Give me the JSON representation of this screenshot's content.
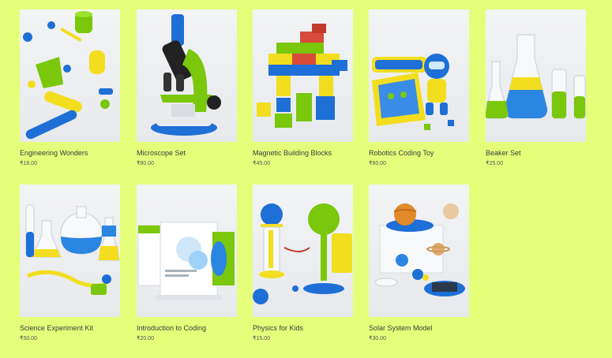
{
  "products": [
    {
      "title": "Engineering Wonders",
      "price": "₹18.00",
      "image": "engineering-parts-icon"
    },
    {
      "title": "Microscope Set",
      "price": "₹80.00",
      "image": "microscope-icon"
    },
    {
      "title": "Magnetic Building Blocks",
      "price": "₹45.00",
      "image": "building-blocks-icon"
    },
    {
      "title": "Robotics Coding Toy",
      "price": "₹60.00",
      "image": "robot-icon"
    },
    {
      "title": "Beaker Set",
      "price": "₹25.00",
      "image": "beakers-icon"
    },
    {
      "title": "Science Experiment Kit",
      "price": "₹50.00",
      "image": "lab-flasks-icon"
    },
    {
      "title": "Introduction to Coding",
      "price": "₹20.00",
      "image": "book-box-icon"
    },
    {
      "title": "Physics for Kids",
      "price": "₹15.00",
      "image": "pendulum-icon"
    },
    {
      "title": "Solar System Model",
      "price": "₹30.00",
      "image": "planets-icon"
    }
  ],
  "colors": {
    "background": "#e6ff7a",
    "blue": "#1e6fd6",
    "yellow": "#f2de1f",
    "green": "#7ac70c"
  }
}
